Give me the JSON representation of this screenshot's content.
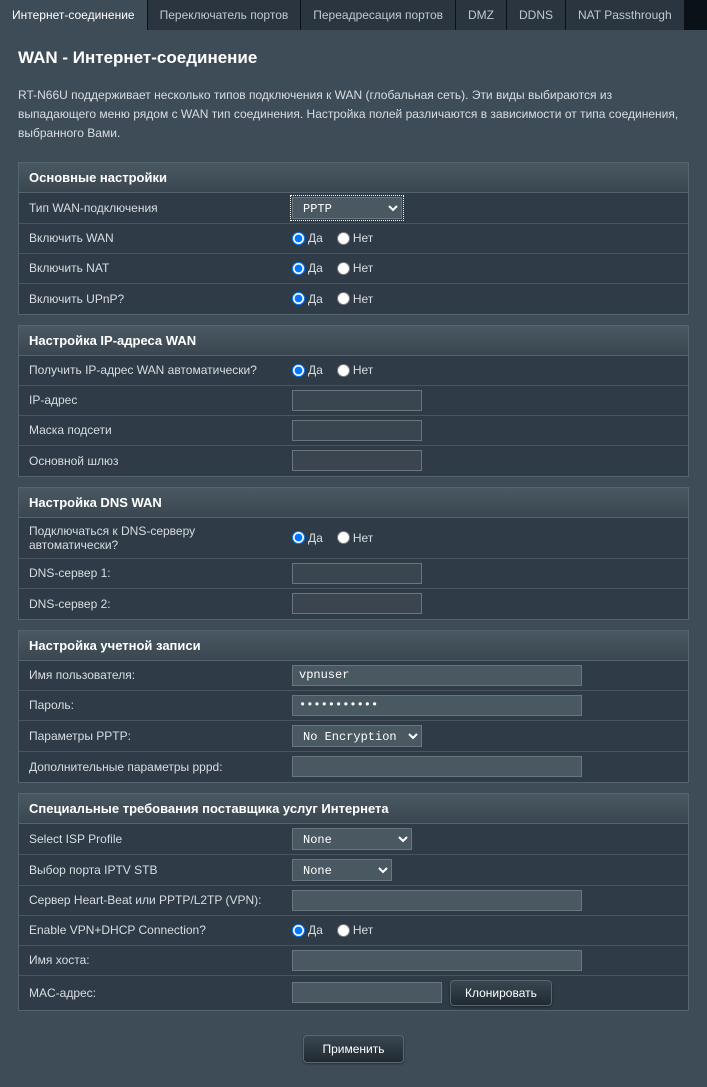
{
  "tabs": [
    {
      "label": "Интернет-соединение",
      "active": true
    },
    {
      "label": "Переключатель портов",
      "active": false
    },
    {
      "label": "Переадресация портов",
      "active": false
    },
    {
      "label": "DMZ",
      "active": false
    },
    {
      "label": "DDNS",
      "active": false
    },
    {
      "label": "NAT Passthrough",
      "active": false
    }
  ],
  "page_title": "WAN - Интернет-соединение",
  "description": "RT-N66U поддерживает несколько типов подключения к WAN (глобальная сеть). Эти виды выбираются из выпадающего меню рядом с WAN тип соединения. Настройка полей различаются в зависимости от типа соединения, выбранного Вами.",
  "radio_yes": "Да",
  "radio_no": "Нет",
  "sections": {
    "basic": {
      "header": "Основные настройки",
      "wan_type_label": "Тип WAN-подключения",
      "wan_type_value": "PPTP",
      "enable_wan_label": "Включить WAN",
      "enable_nat_label": "Включить NAT",
      "enable_upnp_label": "Включить UPnP?"
    },
    "wan_ip": {
      "header": "Настройка IP-адреса WAN",
      "auto_ip_label": "Получить IP-адрес WAN автоматически?",
      "ip_label": "IP-адрес",
      "mask_label": "Маска подсети",
      "gateway_label": "Основной шлюз"
    },
    "dns": {
      "header": "Настройка DNS WAN",
      "auto_dns_label": "Подключаться к DNS-серверу автоматически?",
      "dns1_label": "DNS-сервер 1:",
      "dns2_label": "DNS-сервер 2:"
    },
    "account": {
      "header": "Настройка учетной записи",
      "username_label": "Имя пользователя:",
      "username_value": "vpnuser",
      "password_label": "Пароль:",
      "password_value": "•••••••••••",
      "pptp_params_label": "Параметры PPTP:",
      "pptp_params_value": "No Encryption",
      "pppd_extra_label": "Дополнительные параметры pppd:"
    },
    "isp": {
      "header": "Специальные требования поставщика услуг Интернета",
      "isp_profile_label": "Select ISP Profile",
      "isp_profile_value": "None",
      "iptv_port_label": "Выбор порта IPTV STB",
      "iptv_port_value": "None",
      "heartbeat_label": "Сервер Heart-Beat или PPTP/L2TP (VPN):",
      "vpn_dhcp_label": "Enable VPN+DHCP Connection?",
      "hostname_label": "Имя хоста:",
      "mac_label": "MAC-адрес:",
      "clone_button": "Клонировать"
    }
  },
  "apply_button": "Применить"
}
